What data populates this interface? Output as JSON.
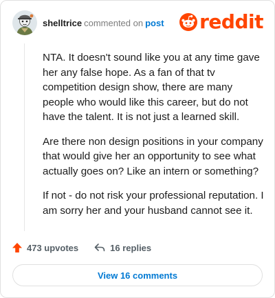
{
  "comment": {
    "username": "shelltrice",
    "action_text": "commented on",
    "target_label": "post",
    "body": [
      "NTA. It doesn't sound like you at any time gave her any false hope. As a fan of that tv competition design show, there are many people who would like this career, but do not have the talent. It is not just a learned skill.",
      "Are there non design positions in your company that would give her an opportunity to see what actually goes on? Like an intern or something?",
      "If not - do not risk your professional reputation. I am sorry her and your husband cannot see it."
    ]
  },
  "brand": {
    "name": "reddit",
    "color": "#ff4500"
  },
  "actions": {
    "upvotes": "473 upvotes",
    "replies": "16 replies"
  },
  "view_button": {
    "label": "View 16 comments"
  },
  "icons": [
    "avatar",
    "reddit-logo-icon",
    "upvote-arrow-icon",
    "reply-arrow-icon"
  ],
  "colors": {
    "accent": "#0079d3",
    "upvote": "#ff4500",
    "muted": "#7c7c7c"
  }
}
